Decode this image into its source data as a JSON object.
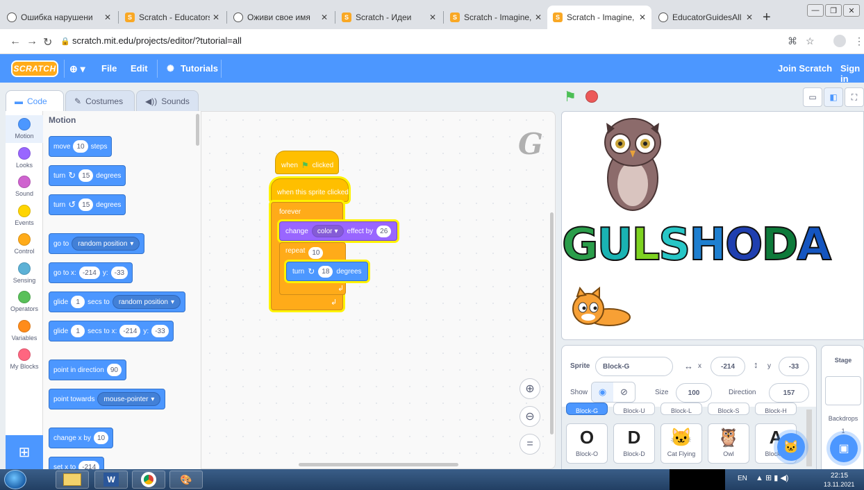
{
  "browser": {
    "tabs": [
      {
        "title": "Ошибка нарушени",
        "icon": "globe"
      },
      {
        "title": "Scratch - Educators",
        "icon": "scratch"
      },
      {
        "title": "Оживи свое имя",
        "icon": "globe"
      },
      {
        "title": "Scratch - Идеи",
        "icon": "scratch"
      },
      {
        "title": "Scratch - Imagine, P",
        "icon": "scratch"
      },
      {
        "title": "Scratch - Imagine, P",
        "icon": "scratch"
      },
      {
        "title": "EducatorGuidesAll",
        "icon": "globe"
      }
    ],
    "url": "scratch.mit.edu/projects/editor/?tutorial=all"
  },
  "menubar": {
    "logo": "SCRATCH",
    "file": "File",
    "edit": "Edit",
    "tutorials": "Tutorials",
    "join": "Join Scratch",
    "signin": "Sign in"
  },
  "editor_tabs": {
    "code": "Code",
    "costumes": "Costumes",
    "sounds": "Sounds"
  },
  "categories": [
    {
      "label": "Motion",
      "color": "#4c97ff"
    },
    {
      "label": "Looks",
      "color": "#9966ff"
    },
    {
      "label": "Sound",
      "color": "#cf63cf"
    },
    {
      "label": "Events",
      "color": "#ffd500"
    },
    {
      "label": "Control",
      "color": "#ffab19"
    },
    {
      "label": "Sensing",
      "color": "#5cb1d6"
    },
    {
      "label": "Operators",
      "color": "#59c059"
    },
    {
      "label": "Variables",
      "color": "#ff8c1a"
    },
    {
      "label": "My Blocks",
      "color": "#ff6680"
    }
  ],
  "palette": {
    "title": "Motion",
    "move": {
      "a": "move",
      "n": "10",
      "b": "steps"
    },
    "turn_right": {
      "a": "turn",
      "n": "15",
      "b": "degrees"
    },
    "turn_left": {
      "a": "turn",
      "n": "15",
      "b": "degrees"
    },
    "goto": {
      "a": "go to",
      "dd": "random position"
    },
    "gotoxy": {
      "a": "go to x:",
      "x": "-214",
      "y_label": "y:",
      "y": "-33"
    },
    "glide": {
      "a": "glide",
      "n": "1",
      "b": "secs to",
      "dd": "random position"
    },
    "glidexy": {
      "a": "glide",
      "n": "1",
      "b": "secs to x:",
      "x": "-214",
      "y_label": "y:",
      "y": "-33"
    },
    "direction": {
      "a": "point in direction",
      "n": "90"
    },
    "towards": {
      "a": "point towards",
      "dd": "mouse-pointer"
    },
    "changex": {
      "a": "change x by",
      "n": "10"
    },
    "setx": {
      "a": "set x to",
      "n": "-214"
    }
  },
  "script": {
    "hat_flag": {
      "a": "when",
      "b": "clicked"
    },
    "hat_sprite": "when this sprite clicked",
    "forever": "forever",
    "change": {
      "a": "change",
      "dd": "color",
      "b": "effect by",
      "n": "26"
    },
    "repeat": {
      "a": "repeat",
      "n": "10"
    },
    "turn": {
      "a": "turn",
      "n": "18",
      "b": "degrees"
    },
    "corner_letter": "G"
  },
  "stage": {
    "word": [
      "G",
      "U",
      "L",
      "S",
      "H",
      "O",
      "D",
      "A"
    ],
    "letter_colors": [
      "#2a9d4a",
      "#1ab3b3",
      "#7ed321",
      "#27c6c6",
      "#1e7fd0",
      "#1f3fb0",
      "#0d7a3a",
      "#1455c0"
    ]
  },
  "sprite_info": {
    "sprite_label": "Sprite",
    "sprite_name": "Block-G",
    "x_label": "x",
    "x": "-214",
    "y_label": "y",
    "y": "-33",
    "show_label": "Show",
    "size_label": "Size",
    "size": "100",
    "direction_label": "Direction",
    "direction": "157"
  },
  "sprites_top": [
    "Block-G",
    "Block-U",
    "Block-L",
    "Block-S",
    "Block-H"
  ],
  "sprites": [
    {
      "name": "Block-O",
      "glyph": "O"
    },
    {
      "name": "Block-D",
      "glyph": "D"
    },
    {
      "name": "Cat Flying",
      "glyph": "🐱"
    },
    {
      "name": "Owl",
      "glyph": "🦉"
    },
    {
      "name": "Block-A",
      "glyph": "A"
    }
  ],
  "stage_panel": {
    "title": "Stage",
    "backdrops": "Backdrops",
    "count": "1"
  },
  "taskbar": {
    "lang": "EN",
    "time": "22:15",
    "date": "13.11.2021"
  }
}
